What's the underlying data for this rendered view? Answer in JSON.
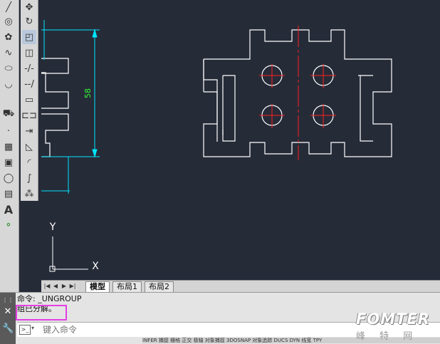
{
  "canvas": {
    "colors": {
      "background": "#262b38",
      "lines": "#ffffff",
      "centerlines": "#ff1f1f",
      "dimension": "#00e5ff",
      "dimension_text": "#33ff33"
    },
    "dimension_text": "58",
    "ucs": {
      "y_label": "Y",
      "x_label": "X"
    }
  },
  "layout_tabs": [
    "模型",
    "布局1",
    "布局2"
  ],
  "nav_buttons": [
    "first-icon",
    "prev-icon",
    "next-icon",
    "last-icon"
  ],
  "command": {
    "history": [
      "命令: _UNGROUP",
      "组已分解。"
    ],
    "placeholder": "键入命令"
  },
  "statusbar": [
    "INFER",
    "捕捉",
    "栅格",
    "正交",
    "极轴",
    "对象捕捉",
    "3DOSNAP",
    "对象追踪",
    "DUCS",
    "DYN",
    "线宽",
    "TPY"
  ],
  "draw_tools": [
    "line-icon",
    "circle-icon",
    "revcloud-icon",
    "spline-icon",
    "ellipse-icon",
    "ellipse-arc-icon",
    "insert-block-icon",
    "point-icon",
    "hatch-icon",
    "gradient-icon",
    "region-icon",
    "table-icon",
    "mtext-icon",
    "add-selected-icon"
  ],
  "modify_tools": [
    "move-icon",
    "rotate-icon",
    "trim-icon",
    "extend-icon",
    "break-icon",
    "join-icon",
    "chamfer-icon",
    "fillet-icon",
    "blend-icon",
    "explode-icon"
  ],
  "brand": {
    "name": "FOMTER",
    "subtitle": "峰 特 网"
  }
}
